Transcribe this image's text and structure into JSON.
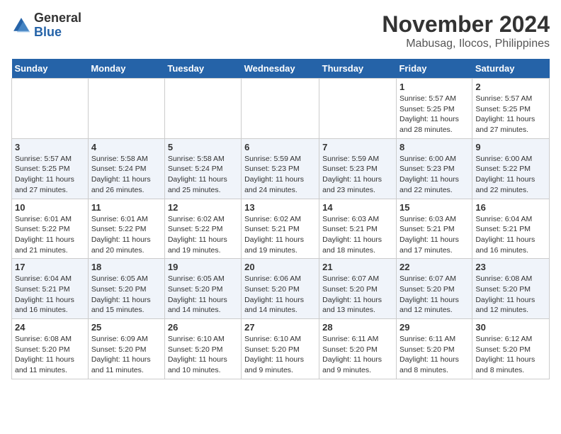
{
  "logo": {
    "general": "General",
    "blue": "Blue"
  },
  "header": {
    "month_year": "November 2024",
    "location": "Mabusag, Ilocos, Philippines"
  },
  "days_of_week": [
    "Sunday",
    "Monday",
    "Tuesday",
    "Wednesday",
    "Thursday",
    "Friday",
    "Saturday"
  ],
  "weeks": [
    [
      {
        "day": "",
        "info": ""
      },
      {
        "day": "",
        "info": ""
      },
      {
        "day": "",
        "info": ""
      },
      {
        "day": "",
        "info": ""
      },
      {
        "day": "",
        "info": ""
      },
      {
        "day": "1",
        "info": "Sunrise: 5:57 AM\nSunset: 5:25 PM\nDaylight: 11 hours and 28 minutes."
      },
      {
        "day": "2",
        "info": "Sunrise: 5:57 AM\nSunset: 5:25 PM\nDaylight: 11 hours and 27 minutes."
      }
    ],
    [
      {
        "day": "3",
        "info": "Sunrise: 5:57 AM\nSunset: 5:25 PM\nDaylight: 11 hours and 27 minutes."
      },
      {
        "day": "4",
        "info": "Sunrise: 5:58 AM\nSunset: 5:24 PM\nDaylight: 11 hours and 26 minutes."
      },
      {
        "day": "5",
        "info": "Sunrise: 5:58 AM\nSunset: 5:24 PM\nDaylight: 11 hours and 25 minutes."
      },
      {
        "day": "6",
        "info": "Sunrise: 5:59 AM\nSunset: 5:23 PM\nDaylight: 11 hours and 24 minutes."
      },
      {
        "day": "7",
        "info": "Sunrise: 5:59 AM\nSunset: 5:23 PM\nDaylight: 11 hours and 23 minutes."
      },
      {
        "day": "8",
        "info": "Sunrise: 6:00 AM\nSunset: 5:23 PM\nDaylight: 11 hours and 22 minutes."
      },
      {
        "day": "9",
        "info": "Sunrise: 6:00 AM\nSunset: 5:22 PM\nDaylight: 11 hours and 22 minutes."
      }
    ],
    [
      {
        "day": "10",
        "info": "Sunrise: 6:01 AM\nSunset: 5:22 PM\nDaylight: 11 hours and 21 minutes."
      },
      {
        "day": "11",
        "info": "Sunrise: 6:01 AM\nSunset: 5:22 PM\nDaylight: 11 hours and 20 minutes."
      },
      {
        "day": "12",
        "info": "Sunrise: 6:02 AM\nSunset: 5:22 PM\nDaylight: 11 hours and 19 minutes."
      },
      {
        "day": "13",
        "info": "Sunrise: 6:02 AM\nSunset: 5:21 PM\nDaylight: 11 hours and 19 minutes."
      },
      {
        "day": "14",
        "info": "Sunrise: 6:03 AM\nSunset: 5:21 PM\nDaylight: 11 hours and 18 minutes."
      },
      {
        "day": "15",
        "info": "Sunrise: 6:03 AM\nSunset: 5:21 PM\nDaylight: 11 hours and 17 minutes."
      },
      {
        "day": "16",
        "info": "Sunrise: 6:04 AM\nSunset: 5:21 PM\nDaylight: 11 hours and 16 minutes."
      }
    ],
    [
      {
        "day": "17",
        "info": "Sunrise: 6:04 AM\nSunset: 5:21 PM\nDaylight: 11 hours and 16 minutes."
      },
      {
        "day": "18",
        "info": "Sunrise: 6:05 AM\nSunset: 5:20 PM\nDaylight: 11 hours and 15 minutes."
      },
      {
        "day": "19",
        "info": "Sunrise: 6:05 AM\nSunset: 5:20 PM\nDaylight: 11 hours and 14 minutes."
      },
      {
        "day": "20",
        "info": "Sunrise: 6:06 AM\nSunset: 5:20 PM\nDaylight: 11 hours and 14 minutes."
      },
      {
        "day": "21",
        "info": "Sunrise: 6:07 AM\nSunset: 5:20 PM\nDaylight: 11 hours and 13 minutes."
      },
      {
        "day": "22",
        "info": "Sunrise: 6:07 AM\nSunset: 5:20 PM\nDaylight: 11 hours and 12 minutes."
      },
      {
        "day": "23",
        "info": "Sunrise: 6:08 AM\nSunset: 5:20 PM\nDaylight: 11 hours and 12 minutes."
      }
    ],
    [
      {
        "day": "24",
        "info": "Sunrise: 6:08 AM\nSunset: 5:20 PM\nDaylight: 11 hours and 11 minutes."
      },
      {
        "day": "25",
        "info": "Sunrise: 6:09 AM\nSunset: 5:20 PM\nDaylight: 11 hours and 11 minutes."
      },
      {
        "day": "26",
        "info": "Sunrise: 6:10 AM\nSunset: 5:20 PM\nDaylight: 11 hours and 10 minutes."
      },
      {
        "day": "27",
        "info": "Sunrise: 6:10 AM\nSunset: 5:20 PM\nDaylight: 11 hours and 9 minutes."
      },
      {
        "day": "28",
        "info": "Sunrise: 6:11 AM\nSunset: 5:20 PM\nDaylight: 11 hours and 9 minutes."
      },
      {
        "day": "29",
        "info": "Sunrise: 6:11 AM\nSunset: 5:20 PM\nDaylight: 11 hours and 8 minutes."
      },
      {
        "day": "30",
        "info": "Sunrise: 6:12 AM\nSunset: 5:20 PM\nDaylight: 11 hours and 8 minutes."
      }
    ]
  ]
}
